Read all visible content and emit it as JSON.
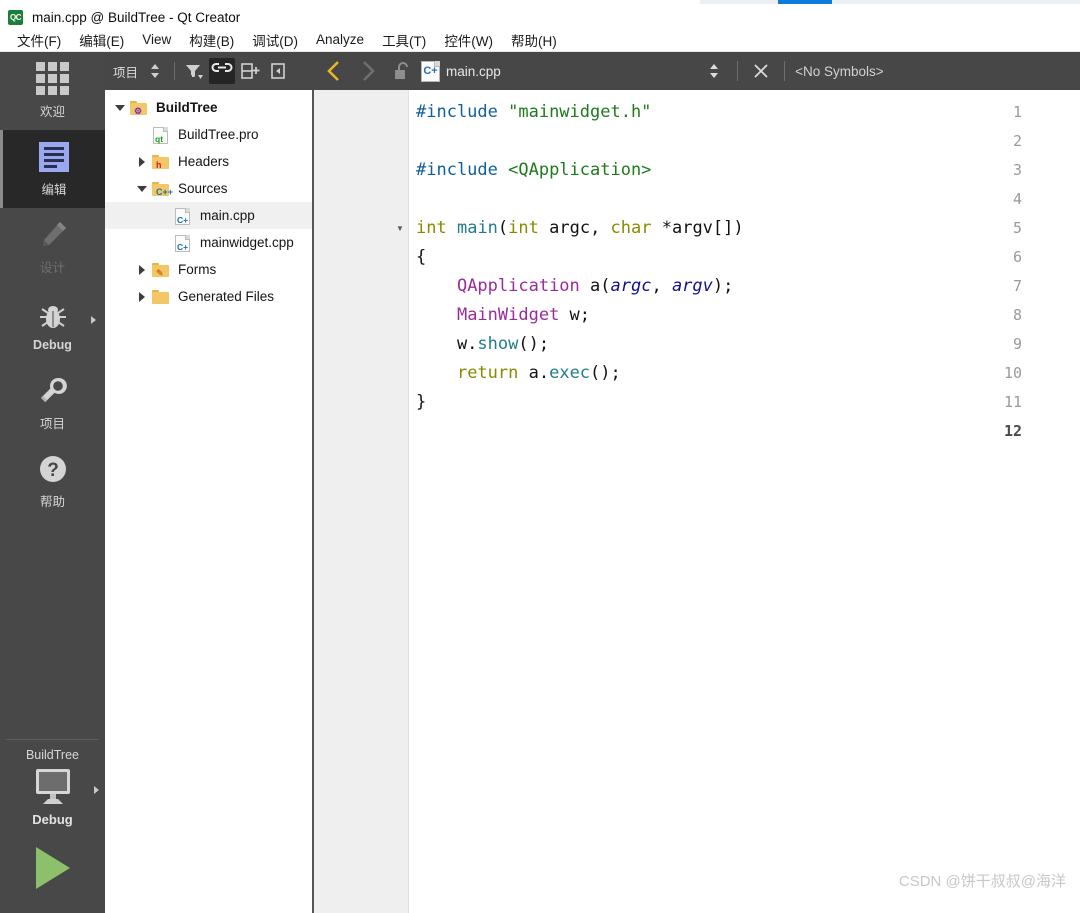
{
  "window": {
    "title": "main.cpp @ BuildTree - Qt Creator",
    "app_icon": "qt-creator-icon"
  },
  "menubar": {
    "items": [
      {
        "label": "文件(F)",
        "mnemonic": "F"
      },
      {
        "label": "编辑(E)",
        "mnemonic": "E"
      },
      {
        "label": "View",
        "mnemonic": "V"
      },
      {
        "label": "构建(B)",
        "mnemonic": "B"
      },
      {
        "label": "调试(D)",
        "mnemonic": "D"
      },
      {
        "label": "Analyze",
        "mnemonic": "A"
      },
      {
        "label": "工具(T)",
        "mnemonic": "T"
      },
      {
        "label": "控件(W)",
        "mnemonic": "W"
      },
      {
        "label": "帮助(H)",
        "mnemonic": "H"
      }
    ]
  },
  "modebar": {
    "items": [
      {
        "label": "欢迎",
        "icon": "grid-icon",
        "selected": false,
        "disabled": false
      },
      {
        "label": "编辑",
        "icon": "document-lines-icon",
        "selected": true,
        "disabled": false
      },
      {
        "label": "设计",
        "icon": "pencil-icon",
        "selected": false,
        "disabled": true
      },
      {
        "label": "Debug",
        "icon": "bug-icon",
        "selected": false,
        "disabled": false,
        "has_arrow": true
      },
      {
        "label": "项目",
        "icon": "wrench-icon",
        "selected": false,
        "disabled": false
      },
      {
        "label": "帮助",
        "icon": "question-mark-icon",
        "selected": false,
        "disabled": false
      }
    ],
    "kit": {
      "project_name": "BuildTree",
      "build_config": "Debug",
      "target_icon": "monitor-icon",
      "run_icon": "run-triangle-icon"
    }
  },
  "nav_toolbar": {
    "view_label": "项目",
    "buttons": [
      {
        "name": "updown-selector",
        "icon": "updown-arrows-icon"
      },
      {
        "name": "filter",
        "icon": "filter-icon"
      },
      {
        "name": "sync-with-editor",
        "icon": "link-icon",
        "active": true
      },
      {
        "name": "split-view",
        "icon": "split-add-icon"
      },
      {
        "name": "close-sidebar",
        "icon": "sidebar-toggle-icon"
      }
    ]
  },
  "editor_toolbar": {
    "back_label": "back-arrow",
    "forward_label": "forward-arrow",
    "lock_state": "unlocked",
    "file_icon": "cpp-file-icon",
    "file_name": "main.cpp",
    "symbols_text": "<No Symbols>",
    "close_label": "close-editor"
  },
  "project_tree": {
    "rows": [
      {
        "depth": 0,
        "twisty": "down",
        "icon": "folder-project",
        "badge": "⚙",
        "badge_color": "#7a2fb0",
        "label": "BuildTree",
        "bold": true,
        "selected": false
      },
      {
        "depth": 1,
        "twisty": "none",
        "icon": "doc-qt",
        "badge": "qt",
        "badge_color": "#1a9e1a",
        "label": "BuildTree.pro",
        "bold": false,
        "selected": false
      },
      {
        "depth": 1,
        "twisty": "right",
        "icon": "folder-headers",
        "badge": "h",
        "badge_color": "#d0202a",
        "label": "Headers",
        "bold": false,
        "selected": false
      },
      {
        "depth": 1,
        "twisty": "down",
        "icon": "folder-sources",
        "badge": "C++",
        "badge_color": "#1a6fae",
        "label": "Sources",
        "bold": false,
        "selected": false
      },
      {
        "depth": 2,
        "twisty": "none",
        "icon": "doc-cpp",
        "badge": "C+",
        "badge_color": "#1a6fae",
        "label": "main.cpp",
        "bold": false,
        "selected": true
      },
      {
        "depth": 2,
        "twisty": "none",
        "icon": "doc-cpp",
        "badge": "C+",
        "badge_color": "#1a6fae",
        "label": "mainwidget.cpp",
        "bold": false,
        "selected": false
      },
      {
        "depth": 1,
        "twisty": "right",
        "icon": "folder-forms",
        "badge": "✎",
        "badge_color": "#d07a10",
        "label": "Forms",
        "bold": false,
        "selected": false
      },
      {
        "depth": 1,
        "twisty": "right",
        "icon": "folder-plain",
        "badge": "",
        "badge_color": "#f3c768",
        "label": "Generated Files",
        "bold": false,
        "selected": false
      }
    ]
  },
  "editor": {
    "current_line": 12,
    "lines": [
      {
        "n": 1,
        "fold": false,
        "tokens": [
          {
            "t": "pre",
            "s": "#include "
          },
          {
            "t": "str",
            "s": "\"mainwidget.h\""
          }
        ]
      },
      {
        "n": 2,
        "fold": false,
        "tokens": []
      },
      {
        "n": 3,
        "fold": false,
        "tokens": [
          {
            "t": "pre",
            "s": "#include "
          },
          {
            "t": "str",
            "s": "<QApplication>"
          }
        ]
      },
      {
        "n": 4,
        "fold": false,
        "tokens": []
      },
      {
        "n": 5,
        "fold": true,
        "tokens": [
          {
            "t": "key",
            "s": "int"
          },
          {
            "t": "pln",
            "s": " "
          },
          {
            "t": "fn",
            "s": "main"
          },
          {
            "t": "pln",
            "s": "("
          },
          {
            "t": "key",
            "s": "int"
          },
          {
            "t": "pln",
            "s": " argc, "
          },
          {
            "t": "key",
            "s": "char"
          },
          {
            "t": "pln",
            "s": " *argv[])"
          }
        ]
      },
      {
        "n": 6,
        "fold": false,
        "tokens": [
          {
            "t": "pln",
            "s": "{"
          }
        ]
      },
      {
        "n": 7,
        "fold": false,
        "tokens": [
          {
            "t": "pln",
            "s": "    "
          },
          {
            "t": "type",
            "s": "QApplication"
          },
          {
            "t": "pln",
            "s": " a("
          },
          {
            "t": "var",
            "s": "argc"
          },
          {
            "t": "pln",
            "s": ", "
          },
          {
            "t": "var",
            "s": "argv"
          },
          {
            "t": "pln",
            "s": ");"
          }
        ]
      },
      {
        "n": 8,
        "fold": false,
        "tokens": [
          {
            "t": "pln",
            "s": "    "
          },
          {
            "t": "type",
            "s": "MainWidget"
          },
          {
            "t": "pln",
            "s": " w;"
          }
        ]
      },
      {
        "n": 9,
        "fold": false,
        "tokens": [
          {
            "t": "pln",
            "s": "    w."
          },
          {
            "t": "fn",
            "s": "show"
          },
          {
            "t": "pln",
            "s": "();"
          }
        ]
      },
      {
        "n": 10,
        "fold": false,
        "tokens": [
          {
            "t": "pln",
            "s": "    "
          },
          {
            "t": "key",
            "s": "return"
          },
          {
            "t": "pln",
            "s": " a."
          },
          {
            "t": "fn",
            "s": "exec"
          },
          {
            "t": "pln",
            "s": "();"
          }
        ]
      },
      {
        "n": 11,
        "fold": false,
        "tokens": [
          {
            "t": "pln",
            "s": "}"
          }
        ]
      },
      {
        "n": 12,
        "fold": false,
        "tokens": []
      }
    ]
  },
  "watermark": {
    "text": "CSDN @饼干叔叔@海洋"
  },
  "colors": {
    "toolbar_bg": "#474747",
    "modebar_bg": "#484848",
    "mode_selected_bg": "#282828",
    "accent_yellow": "#e8b52a",
    "run_green": "#8dc06a",
    "gutter_bg": "#efefef"
  }
}
